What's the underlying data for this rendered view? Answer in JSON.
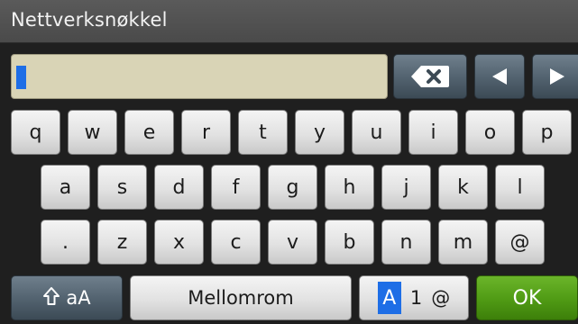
{
  "header": {
    "title": "Nettverksnøkkel"
  },
  "input": {
    "value": ""
  },
  "keyboard": {
    "row1": [
      "q",
      "w",
      "e",
      "r",
      "t",
      "y",
      "u",
      "i",
      "o",
      "p"
    ],
    "row2": [
      "a",
      "s",
      "d",
      "f",
      "g",
      "h",
      "j",
      "k",
      "l"
    ],
    "row3": [
      ".",
      "z",
      "x",
      "c",
      "v",
      "b",
      "n",
      "m",
      "@"
    ],
    "shift_label": "aA",
    "space_label": "Mellomrom",
    "mode_labels": [
      "A",
      "1",
      "@"
    ],
    "ok_label": "OK"
  },
  "colors": {
    "cursor": "#1e6ee6",
    "ok": "#4f9a14",
    "dark_key": "#51616e",
    "input_bg": "#d9d4b6"
  },
  "icons": {
    "delete": "backspace-x-icon",
    "left": "triangle-left-icon",
    "right": "triangle-right-icon",
    "shift": "shift-arrow-icon"
  }
}
